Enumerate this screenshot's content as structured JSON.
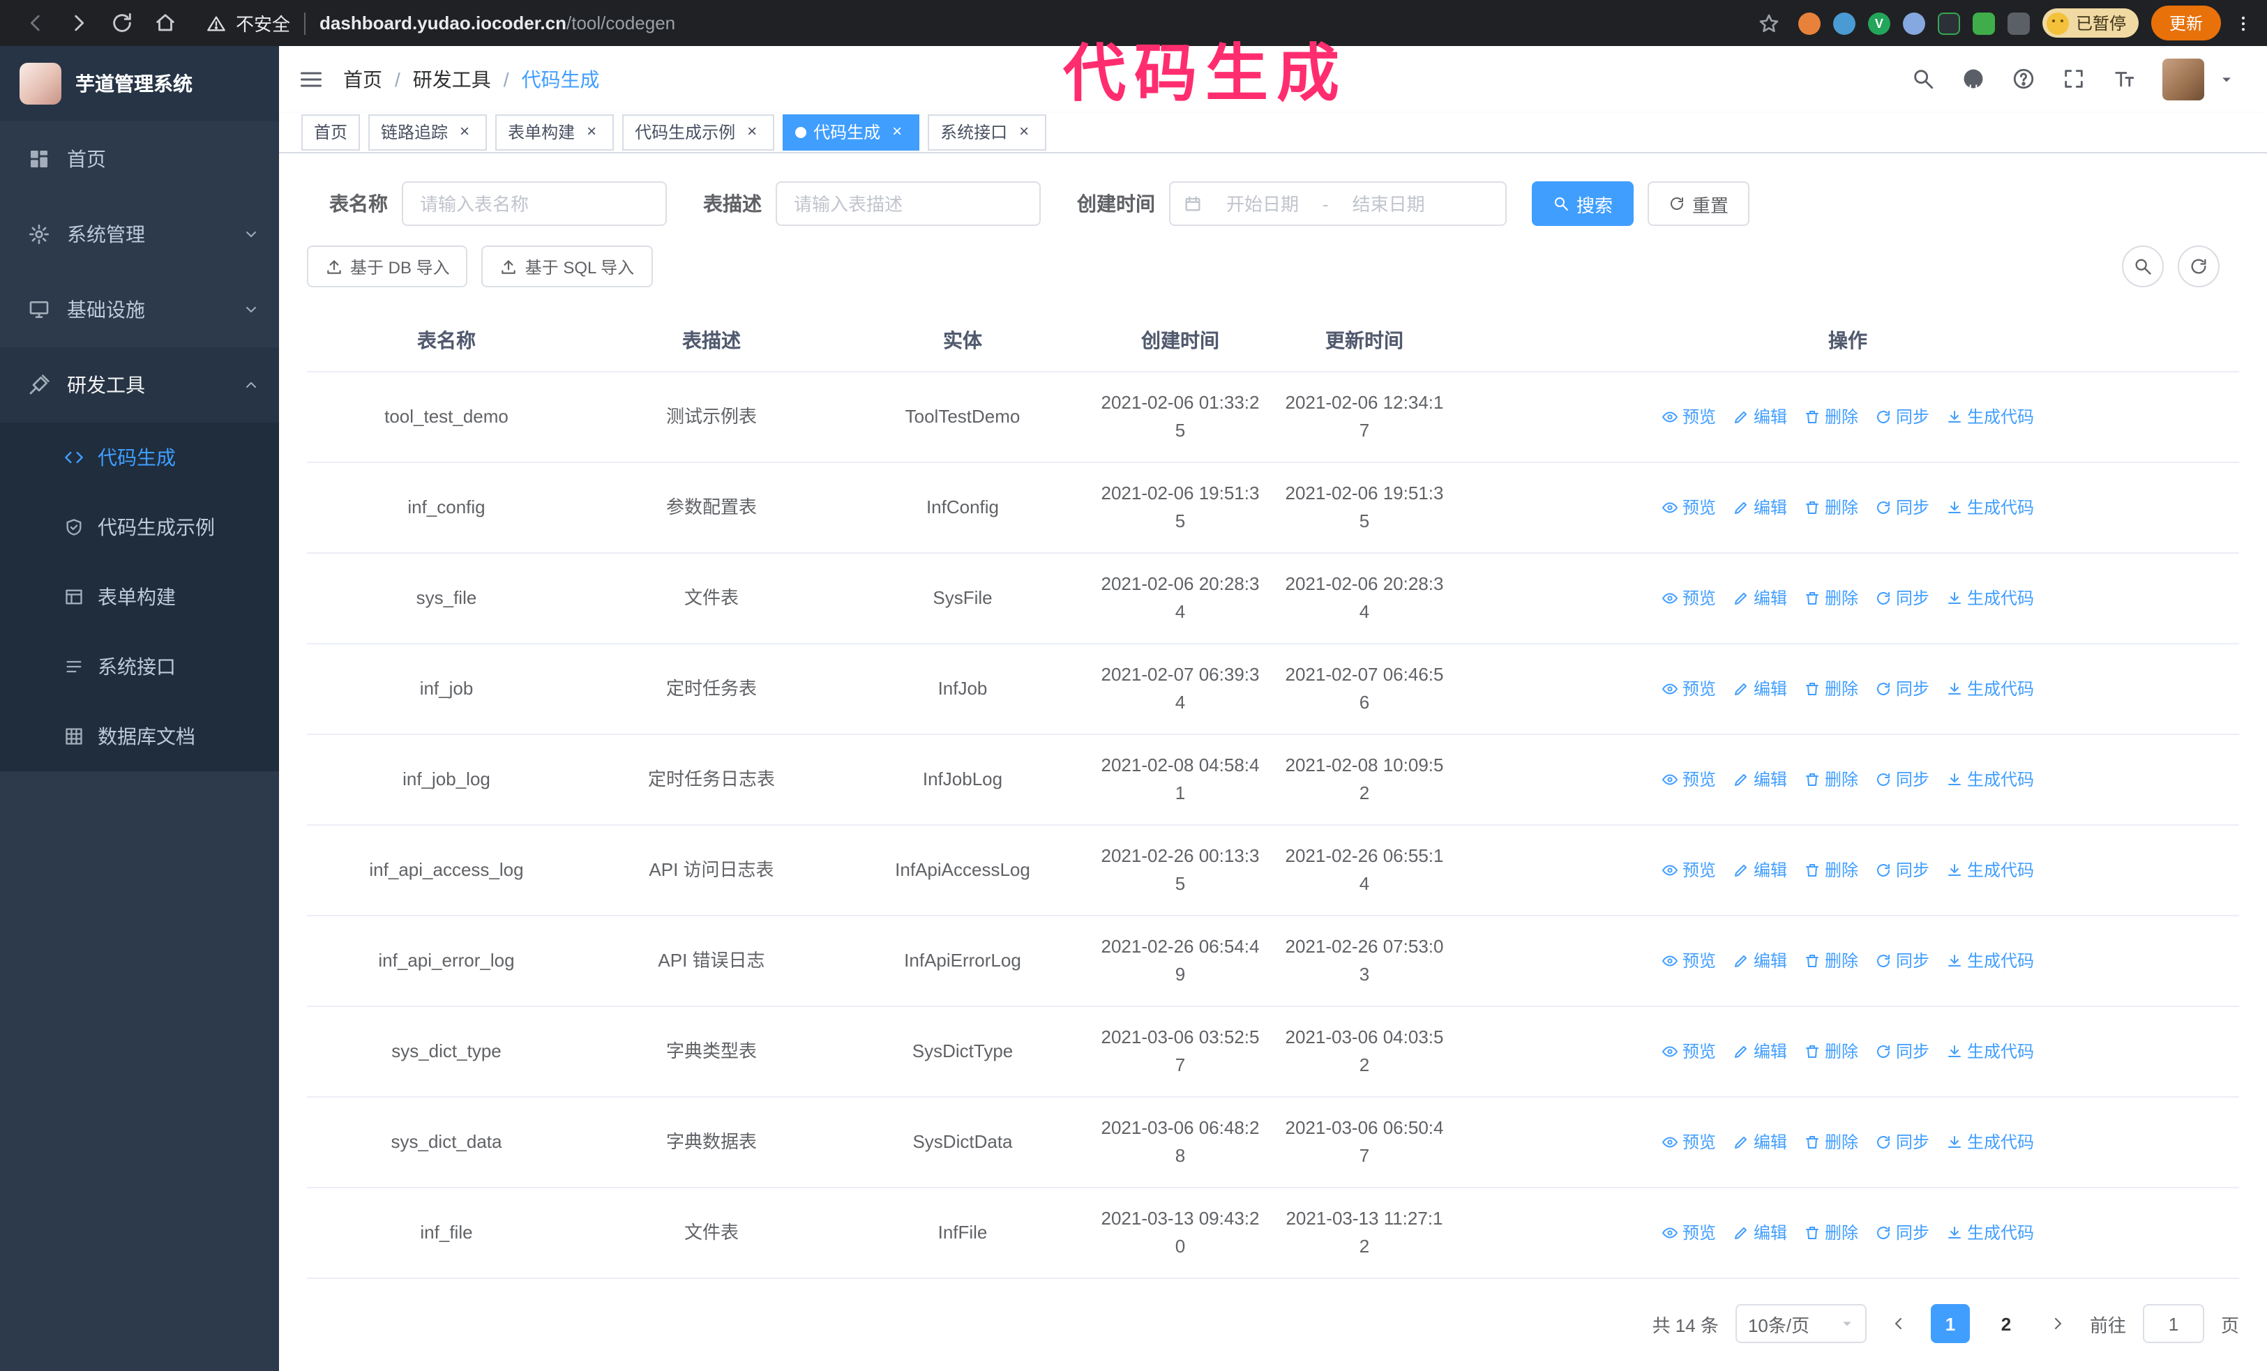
{
  "browser": {
    "security_label": "不安全",
    "url_domain": "dashboard.yudao.iocoder.cn",
    "url_path": "/tool/codegen",
    "paused_badge": "已暂停",
    "update_button": "更新"
  },
  "annotation": {
    "text": "代码生成",
    "color": "#ff2d6f"
  },
  "sidebar": {
    "logo_title": "芋道管理系统",
    "items": [
      {
        "label": "首页",
        "icon": "dashboard-icon"
      },
      {
        "label": "系统管理",
        "icon": "gear-icon"
      },
      {
        "label": "基础设施",
        "icon": "monitor-icon"
      },
      {
        "label": "研发工具",
        "icon": "tools-icon"
      }
    ],
    "subitems": [
      {
        "label": "代码生成",
        "icon": "code-icon",
        "active": true
      },
      {
        "label": "代码生成示例",
        "icon": "badge-icon"
      },
      {
        "label": "表单构建",
        "icon": "form-icon"
      },
      {
        "label": "系统接口",
        "icon": "api-icon"
      },
      {
        "label": "数据库文档",
        "icon": "database-icon"
      }
    ]
  },
  "header": {
    "breadcrumb": [
      "首页",
      "研发工具",
      "代码生成"
    ]
  },
  "tabs": [
    {
      "label": "首页",
      "closable": false,
      "active": false
    },
    {
      "label": "链路追踪",
      "closable": true,
      "active": false
    },
    {
      "label": "表单构建",
      "closable": true,
      "active": false
    },
    {
      "label": "代码生成示例",
      "closable": true,
      "active": false
    },
    {
      "label": "代码生成",
      "closable": true,
      "active": true
    },
    {
      "label": "系统接口",
      "closable": true,
      "active": false
    }
  ],
  "filters": {
    "table_name_label": "表名称",
    "table_name_placeholder": "请输入表名称",
    "table_desc_label": "表描述",
    "table_desc_placeholder": "请输入表描述",
    "create_time_label": "创建时间",
    "date_start_placeholder": "开始日期",
    "date_separator": "-",
    "date_end_placeholder": "结束日期",
    "search_button": "搜索",
    "reset_button": "重置"
  },
  "toolbar": {
    "import_db_button": "基于 DB 导入",
    "import_sql_button": "基于 SQL 导入"
  },
  "table": {
    "columns": [
      "表名称",
      "表描述",
      "实体",
      "创建时间",
      "更新时间",
      "操作"
    ],
    "op_labels": [
      "预览",
      "编辑",
      "删除",
      "同步",
      "生成代码"
    ],
    "op_icons": [
      "eye-icon",
      "edit-icon",
      "trash-icon",
      "sync-icon",
      "download-icon"
    ],
    "rows": [
      {
        "name": "tool_test_demo",
        "desc": "测试示例表",
        "entity": "ToolTestDemo",
        "created": "2021-02-06 01:33:25",
        "updated": "2021-02-06 12:34:17"
      },
      {
        "name": "inf_config",
        "desc": "参数配置表",
        "entity": "InfConfig",
        "created": "2021-02-06 19:51:35",
        "updated": "2021-02-06 19:51:35"
      },
      {
        "name": "sys_file",
        "desc": "文件表",
        "entity": "SysFile",
        "created": "2021-02-06 20:28:34",
        "updated": "2021-02-06 20:28:34"
      },
      {
        "name": "inf_job",
        "desc": "定时任务表",
        "entity": "InfJob",
        "created": "2021-02-07 06:39:34",
        "updated": "2021-02-07 06:46:56"
      },
      {
        "name": "inf_job_log",
        "desc": "定时任务日志表",
        "entity": "InfJobLog",
        "created": "2021-02-08 04:58:41",
        "updated": "2021-02-08 10:09:52"
      },
      {
        "name": "inf_api_access_log",
        "desc": "API 访问日志表",
        "entity": "InfApiAccessLog",
        "created": "2021-02-26 00:13:35",
        "updated": "2021-02-26 06:55:14"
      },
      {
        "name": "inf_api_error_log",
        "desc": "API 错误日志",
        "entity": "InfApiErrorLog",
        "created": "2021-02-26 06:54:49",
        "updated": "2021-02-26 07:53:03"
      },
      {
        "name": "sys_dict_type",
        "desc": "字典类型表",
        "entity": "SysDictType",
        "created": "2021-03-06 03:52:57",
        "updated": "2021-03-06 04:03:52"
      },
      {
        "name": "sys_dict_data",
        "desc": "字典数据表",
        "entity": "SysDictData",
        "created": "2021-03-06 06:48:28",
        "updated": "2021-03-06 06:50:47"
      },
      {
        "name": "inf_file",
        "desc": "文件表",
        "entity": "InfFile",
        "created": "2021-03-13 09:43:20",
        "updated": "2021-03-13 11:27:12"
      }
    ]
  },
  "pagination": {
    "total_text": "共 14 条",
    "page_size": "10条/页",
    "pages": [
      "1",
      "2"
    ],
    "active_page": "1",
    "goto_label": "前往",
    "goto_value": "1",
    "goto_suffix": "页"
  },
  "colors": {
    "accent": "#409eff",
    "annotation_pink": "#ff2d6f",
    "update_button_orange": "#e8710a",
    "sidebar_bg": "#2d3a4b",
    "submenu_bg": "#1f2d3d"
  }
}
